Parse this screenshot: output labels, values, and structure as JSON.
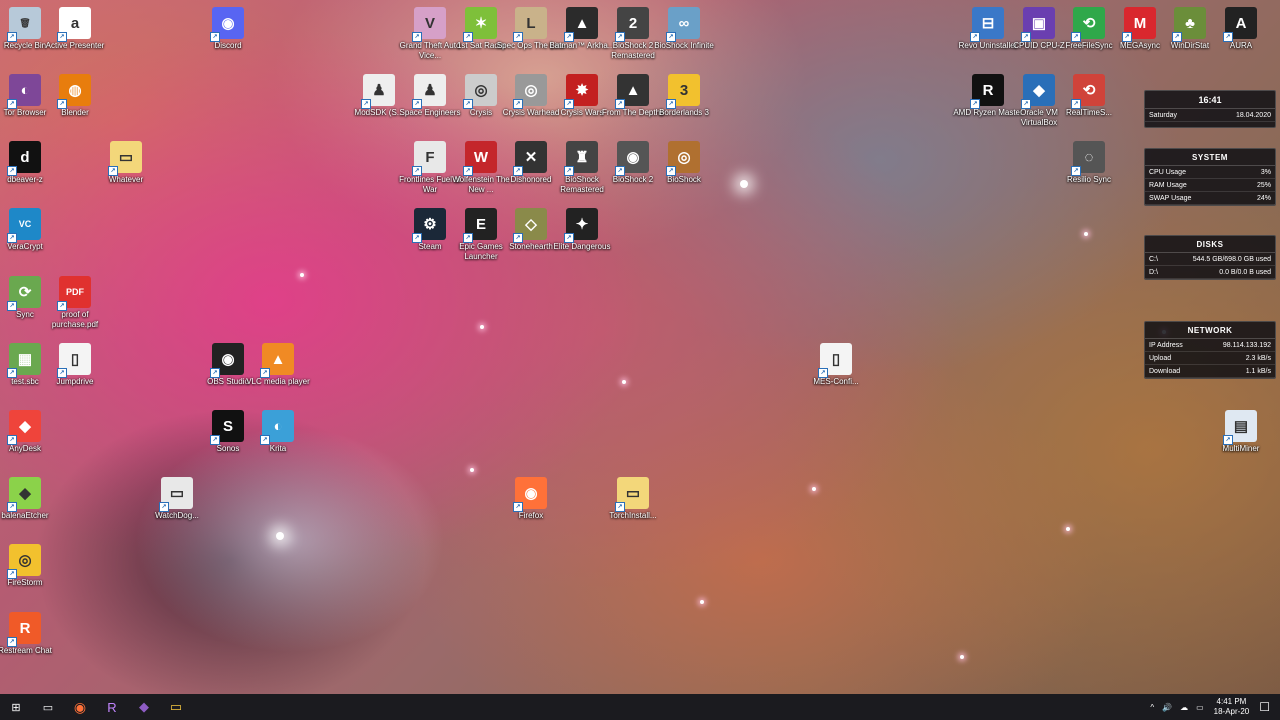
{
  "desktop_icons": [
    {
      "name": "recycle-bin-icon",
      "label": "Recycle Bin",
      "glyph": "🗑",
      "color": "#b7c9d9"
    },
    {
      "name": "active-presenter-icon",
      "label": "Active Presenter",
      "glyph": "a",
      "color": "#ffffff"
    },
    {
      "name": "discord-icon",
      "label": "Discord",
      "glyph": "◉",
      "color": "#5865f2"
    },
    {
      "name": "gta-icon",
      "label": "Grand Theft Auto Vice...",
      "glyph": "V",
      "color": "#d6a0c8"
    },
    {
      "name": "far-cry-icon",
      "label": "1st Sat Radio",
      "glyph": "✶",
      "color": "#7ec03a"
    },
    {
      "name": "spec-ops-icon",
      "label": "Spec Ops The Line",
      "glyph": "L",
      "color": "#c9b28a"
    },
    {
      "name": "batman-icon",
      "label": "Batman™ Arkha...",
      "glyph": "▲",
      "color": "#2b2b2b"
    },
    {
      "name": "bioshock2-icon",
      "label": "BioShock 2 Remastered",
      "glyph": "2",
      "color": "#444"
    },
    {
      "name": "bioshock-infinite-icon",
      "label": "BioShock Infinite",
      "glyph": "∞",
      "color": "#6aa0c8"
    },
    {
      "name": "revo-icon",
      "label": "Revo Uninstaller",
      "glyph": "⊟",
      "color": "#3a78c8"
    },
    {
      "name": "cpuz-icon",
      "label": "CPUID CPU-Z",
      "glyph": "▣",
      "color": "#6a3fb0"
    },
    {
      "name": "freefilesync-icon",
      "label": "FreeFileSync",
      "glyph": "⟲",
      "color": "#2fa84a"
    },
    {
      "name": "mega-icon",
      "label": "MEGAsync",
      "glyph": "M",
      "color": "#d9272e"
    },
    {
      "name": "windirstat-icon",
      "label": "WinDirStat",
      "glyph": "♣",
      "color": "#6b8e3a"
    },
    {
      "name": "aura-icon",
      "label": "AURA",
      "glyph": "A",
      "color": "#222"
    },
    {
      "name": "tor-icon",
      "label": "Tor Browser",
      "glyph": "◐",
      "color": "#7e4798"
    },
    {
      "name": "blender-icon",
      "label": "Blender",
      "glyph": "◍",
      "color": "#e87d0d"
    },
    {
      "name": "modsdk-icon",
      "label": "ModSDK (S...",
      "glyph": "♟",
      "color": "#eeeeee"
    },
    {
      "name": "space-engineers-icon",
      "label": "Space Engineers",
      "glyph": "♟",
      "color": "#eeeeee"
    },
    {
      "name": "crysis-icon",
      "label": "Crysis",
      "glyph": "◎",
      "color": "#cccccc"
    },
    {
      "name": "crysis-warhead-icon",
      "label": "Crysis Warhead",
      "glyph": "◎",
      "color": "#999999"
    },
    {
      "name": "crysis-wars-icon",
      "label": "Crysis Wars",
      "glyph": "✸",
      "color": "#c32020"
    },
    {
      "name": "prey-icon",
      "label": "From The Depths",
      "glyph": "▲",
      "color": "#333"
    },
    {
      "name": "borderlands-icon",
      "label": "Borderlands 3",
      "glyph": "3",
      "color": "#f2c12e"
    },
    {
      "name": "amd-ryzen-icon",
      "label": "AMD Ryzen Master",
      "glyph": "R",
      "color": "#111"
    },
    {
      "name": "virtualbox-icon",
      "label": "Oracle VM VirtualBox",
      "glyph": "◆",
      "color": "#2a6fb8"
    },
    {
      "name": "realtimesync-icon",
      "label": "RealTimeS...",
      "glyph": "⟲",
      "color": "#d0433a"
    },
    {
      "name": "dbeaver-icon",
      "label": "dbeaver-z",
      "glyph": "d",
      "color": "#111"
    },
    {
      "name": "whatever-icon",
      "label": "Whatever",
      "glyph": "▭",
      "color": "#f3d77a"
    },
    {
      "name": "frontlines-icon",
      "label": "Frontlines Fuel of War",
      "glyph": "F",
      "color": "#e8e8e8"
    },
    {
      "name": "wolfenstein-icon",
      "label": "Wolfenstein The New ...",
      "glyph": "W",
      "color": "#c4262b"
    },
    {
      "name": "dishonored-icon",
      "label": "Dishonored",
      "glyph": "✕",
      "color": "#333"
    },
    {
      "name": "bioshock-remastered-icon",
      "label": "BioShock Remastered",
      "glyph": "♜",
      "color": "#444"
    },
    {
      "name": "bioshock2b-icon",
      "label": "BioShock 2",
      "glyph": "◉",
      "color": "#555"
    },
    {
      "name": "bioshock-icon",
      "label": "BioShock",
      "glyph": "◎",
      "color": "#b07030"
    },
    {
      "name": "resilio-icon",
      "label": "Resilio Sync",
      "glyph": "◌",
      "color": "#555"
    },
    {
      "name": "veracrypt-icon",
      "label": "VeraCrypt",
      "glyph": "VC",
      "color": "#1e88c8"
    },
    {
      "name": "steam-icon",
      "label": "Steam",
      "glyph": "⚙",
      "color": "#1b2838"
    },
    {
      "name": "epic-icon",
      "label": "Epic Games Launcher",
      "glyph": "E",
      "color": "#222"
    },
    {
      "name": "stonehearth-icon",
      "label": "Stonehearth",
      "glyph": "◇",
      "color": "#8a8a4a"
    },
    {
      "name": "elite-icon",
      "label": "Elite Dangerous",
      "glyph": "✦",
      "color": "#222"
    },
    {
      "name": "sync-icon",
      "label": "Sync",
      "glyph": "⟳",
      "color": "#6aa84f"
    },
    {
      "name": "pdf-icon",
      "label": "proof of purchase.pdf",
      "glyph": "PDF",
      "color": "#e0312f"
    },
    {
      "name": "test-sbc-icon",
      "label": "test.sbc",
      "glyph": "▦",
      "color": "#6aa84f"
    },
    {
      "name": "jumpdrive-icon",
      "label": "Jumpdrive",
      "glyph": "▯",
      "color": "#f4f4f4"
    },
    {
      "name": "obs-icon",
      "label": "OBS Studio",
      "glyph": "◉",
      "color": "#222"
    },
    {
      "name": "vlc-icon",
      "label": "VLC media player",
      "glyph": "▲",
      "color": "#f08a24"
    },
    {
      "name": "mes-config-icon",
      "label": "MES-Confi...",
      "glyph": "▯",
      "color": "#f4f4f4"
    },
    {
      "name": "anydesk-icon",
      "label": "AnyDesk",
      "glyph": "◆",
      "color": "#ef443b"
    },
    {
      "name": "sonos-icon",
      "label": "Sonos",
      "glyph": "S",
      "color": "#111"
    },
    {
      "name": "krita-icon",
      "label": "Krita",
      "glyph": "◐",
      "color": "#3ba0d8"
    },
    {
      "name": "multiminer-icon",
      "label": "MultiMiner",
      "glyph": "▤",
      "color": "#dfe8f2"
    },
    {
      "name": "balenaetcher-icon",
      "label": "balenaEtcher",
      "glyph": "◆",
      "color": "#8bd24a"
    },
    {
      "name": "watchdog-icon",
      "label": "WatchDog...",
      "glyph": "▭",
      "color": "#e8e8e8"
    },
    {
      "name": "firefox-icon",
      "label": "Firefox",
      "glyph": "◉",
      "color": "#ff7139"
    },
    {
      "name": "torchinstall-icon",
      "label": "TorchInstall...",
      "glyph": "▭",
      "color": "#f3d77a"
    },
    {
      "name": "firestorm-icon",
      "label": "FireStorm",
      "glyph": "◎",
      "color": "#f2c12e"
    },
    {
      "name": "restream-icon",
      "label": "Restream Chat",
      "glyph": "R",
      "color": "#f05a28"
    }
  ],
  "widgets": {
    "clock": {
      "time": "16:41",
      "day": "Saturday",
      "date": "18.04.2020"
    },
    "system": {
      "title": "SYSTEM",
      "rows": [
        {
          "label": "CPU Usage",
          "value": "3%"
        },
        {
          "label": "RAM Usage",
          "value": "25%"
        },
        {
          "label": "SWAP Usage",
          "value": "24%"
        }
      ]
    },
    "disks": {
      "title": "DISKS",
      "rows": [
        {
          "label": "C:\\",
          "value": "544.5 GB/698.0 GB used"
        },
        {
          "label": "D:\\",
          "value": "0.0 B/0.0 B used"
        }
      ]
    },
    "network": {
      "title": "NETWORK",
      "rows": [
        {
          "label": "IP Address",
          "value": "98.114.133.192"
        },
        {
          "label": "Upload",
          "value": "2.3 kB/s"
        },
        {
          "label": "Download",
          "value": "1.1 kB/s"
        }
      ]
    }
  },
  "taskbar": {
    "start_glyph": "⊞",
    "task_view_glyph": "▭",
    "pinned": [
      {
        "name": "firefox-taskbar-icon",
        "glyph": "◉",
        "color": "#ff7139"
      },
      {
        "name": "ryzen-taskbar-icon",
        "glyph": "R",
        "color": "#c084fc"
      },
      {
        "name": "visual-studio-taskbar-icon",
        "glyph": "◆",
        "color": "#8e5cc4"
      },
      {
        "name": "file-explorer-taskbar-icon",
        "glyph": "▭",
        "color": "#f3c640"
      }
    ],
    "tray": {
      "chevron": "^",
      "volume": "🔊",
      "cloud": "☁",
      "network": "▭",
      "time": "4:41 PM",
      "date": "18-Apr-20",
      "notifications": "☐"
    }
  }
}
